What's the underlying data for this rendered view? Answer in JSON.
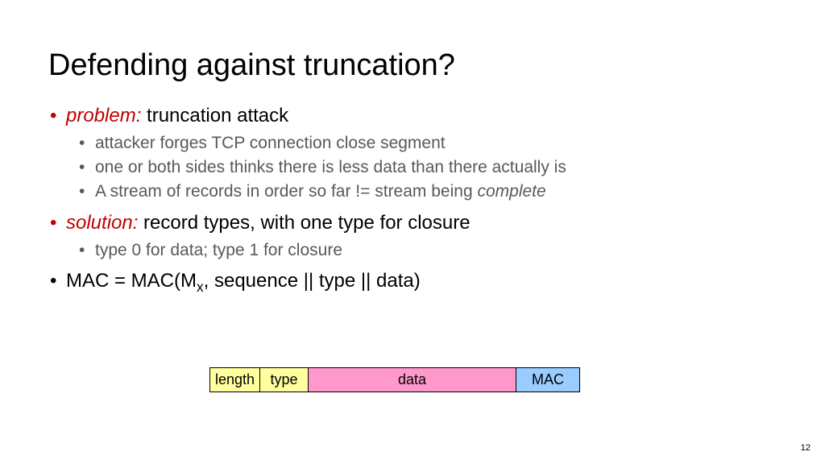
{
  "title": "Defending against truncation?",
  "bullets": {
    "problem": {
      "lead": "problem:",
      "rest": " truncation attack",
      "sub": [
        "attacker forges TCP connection close segment",
        "one or both sides thinks there is less data than there actually is"
      ],
      "sub3_a": "A stream of records in order so far != stream being ",
      "sub3_b": "complete"
    },
    "solution": {
      "lead": "solution:",
      "rest": " record types, with one type for closure",
      "sub": [
        "type 0 for data; type 1 for closure"
      ]
    },
    "mac": {
      "pre": "MAC = MAC(M",
      "sub": "x",
      "post": ", sequence || type || data)"
    }
  },
  "record": {
    "length": "length",
    "type": "type",
    "data": "data",
    "mac": "MAC"
  },
  "page": "12"
}
